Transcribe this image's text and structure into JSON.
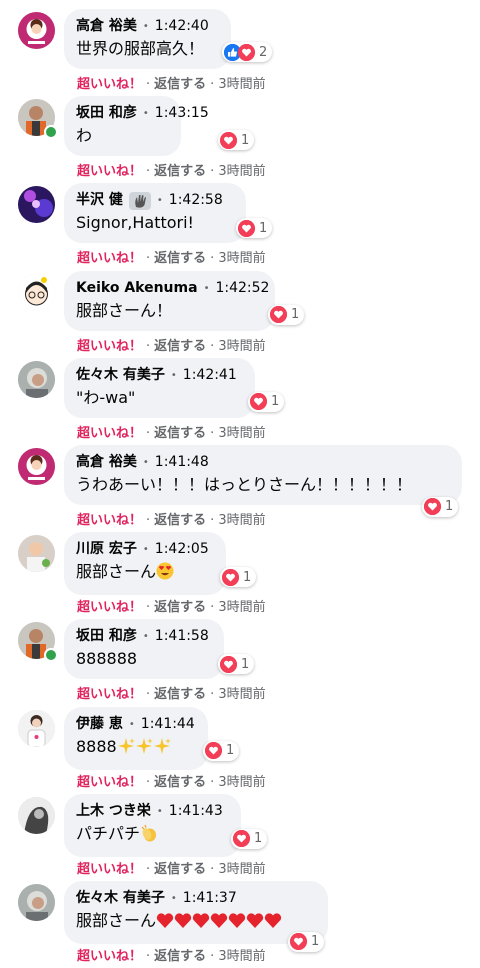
{
  "actions": {
    "super_like": "超いいね！",
    "reply": "返信する",
    "ago": "3時間前"
  },
  "colors": {
    "heart": "#f33e58",
    "like": "#1877f2",
    "online": "#31a24c",
    "bubble": "#f0f2f5"
  },
  "comments": [
    {
      "author": "高倉 裕美",
      "time": "1:42:40",
      "text": "世界の服部高久！",
      "reactions": [
        "like",
        "love"
      ],
      "count": "2",
      "avatar": "kurage-pink",
      "online": false,
      "badge_icon": null
    },
    {
      "author": "坂田 和彦",
      "time": "1:43:15",
      "text": "わ",
      "reactions": [
        "love"
      ],
      "count": "1",
      "avatar": "man-orange",
      "online": true,
      "badge_icon": null
    },
    {
      "author": "半沢 健",
      "time": "1:42:58",
      "text": "Signor,Hattori!",
      "reactions": [
        "love"
      ],
      "count": "1",
      "avatar": "purple-concert",
      "online": false,
      "badge_icon": "waving-hand-icon"
    },
    {
      "author": "Keiko Akenuma",
      "time": "1:42:52",
      "text": "服部さーん！",
      "reactions": [
        "love"
      ],
      "count": "1",
      "avatar": "cartoon-girl",
      "online": false,
      "badge_icon": null
    },
    {
      "author": "佐々木 有美子",
      "time": "1:42:41",
      "text": "\"わ-wa\"",
      "reactions": [
        "love"
      ],
      "count": "1",
      "avatar": "grey-hair",
      "online": false,
      "badge_icon": null
    },
    {
      "author": "高倉 裕美",
      "time": "1:41:48",
      "text": "うわあーい！！！はっとりさーん！！！！！！",
      "reactions": [
        "love"
      ],
      "count": "1",
      "avatar": "kurage-pink",
      "online": false,
      "badge_icon": null
    },
    {
      "author": "川原 宏子",
      "time": "1:42:05",
      "text": "服部さーん",
      "emoji": [
        "heart-eyes"
      ],
      "reactions": [
        "love"
      ],
      "count": "1",
      "avatar": "child-photo",
      "online": false,
      "badge_icon": null
    },
    {
      "author": "坂田 和彦",
      "time": "1:41:58",
      "text": "888888",
      "reactions": [
        "love"
      ],
      "count": "1",
      "avatar": "man-orange",
      "online": true,
      "badge_icon": null
    },
    {
      "author": "伊藤 恵",
      "time": "1:41:44",
      "text": "8888",
      "emoji": [
        "sparkles",
        "sparkles",
        "sparkles"
      ],
      "reactions": [
        "love"
      ],
      "count": "1",
      "avatar": "white-shirt",
      "online": false,
      "badge_icon": null
    },
    {
      "author": "上木 つき栄",
      "time": "1:41:43",
      "text": "パチパチ",
      "emoji": [
        "clap"
      ],
      "reactions": [
        "love"
      ],
      "count": "1",
      "avatar": "bw-portrait",
      "online": false,
      "badge_icon": null
    },
    {
      "author": "佐々木 有美子",
      "time": "1:41:37",
      "text": "服部さーん",
      "emoji": [
        "heart",
        "heart",
        "heart",
        "heart",
        "heart",
        "heart",
        "heart"
      ],
      "reactions": [
        "love"
      ],
      "count": "1",
      "avatar": "grey-hair",
      "online": false,
      "badge_icon": null
    }
  ]
}
